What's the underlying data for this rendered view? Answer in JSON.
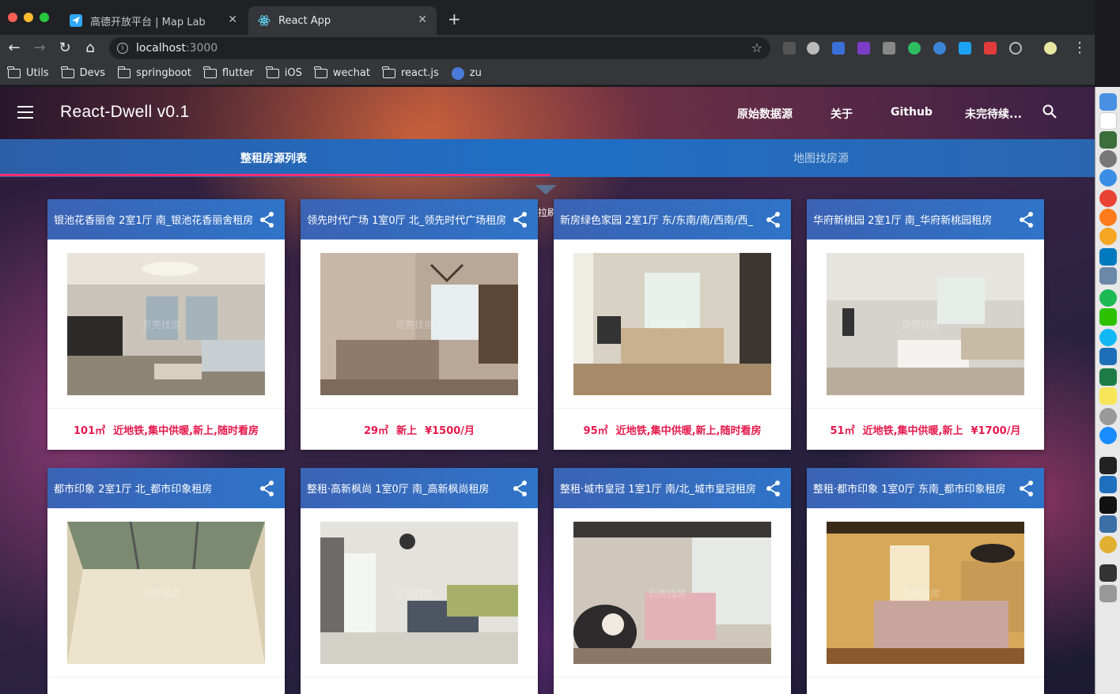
{
  "browser": {
    "tabs": [
      {
        "title": "高德开放平台 | Map Lab",
        "active": false
      },
      {
        "title": "React App",
        "active": true
      }
    ],
    "url_host": "localhost",
    "url_port": ":3000",
    "bookmarks": [
      "Utils",
      "Devs",
      "springboot",
      "flutter",
      "iOS",
      "wechat",
      "react.js",
      "zu"
    ]
  },
  "app": {
    "title": "React-Dwell v0.1",
    "nav": [
      "原始数据源",
      "关于",
      "Github",
      "未完待续..."
    ],
    "tabs": [
      "整租房源列表",
      "地图找房源"
    ],
    "pull_text": "拉刷"
  },
  "listings": [
    {
      "title": "银池花香丽舍 2室1厅 南_银池花香丽舍租房",
      "area": "101㎡",
      "tags": "近地铁,集中供暖,新上,随时看房",
      "price": ""
    },
    {
      "title": "领先时代广场 1室0厅 北_领先时代广场租房",
      "area": "29㎡",
      "tags": "新上",
      "price": "¥1500/月"
    },
    {
      "title": "新房绿色家园 2室1厅 东/东南/南/西南/西_",
      "area": "95㎡",
      "tags": "近地铁,集中供暖,新上,随时看房",
      "price": ""
    },
    {
      "title": "华府新桃园 2室1厅 南_华府新桃园租房",
      "area": "51㎡",
      "tags": "近地铁,集中供暖,新上",
      "price": "¥1700/月"
    },
    {
      "title": "都市印象 2室1厅 北_都市印象租房",
      "area": "",
      "tags": "",
      "price": ""
    },
    {
      "title": "整租·高新枫尚 1室0厅 南_高新枫尚租房",
      "area": "",
      "tags": "",
      "price": ""
    },
    {
      "title": "整租·城市皇冠 1室1厅 南/北_城市皇冠租房",
      "area": "",
      "tags": "",
      "price": ""
    },
    {
      "title": "整租·都市印象 1室0厅 东南_都市印象租房",
      "area": "",
      "tags": "",
      "price": ""
    }
  ],
  "watermark": "贝壳找房",
  "colors": {
    "accent": "#e5194c",
    "tab_indicator": "#ff2d6f",
    "card_header": "#3b63b4"
  }
}
